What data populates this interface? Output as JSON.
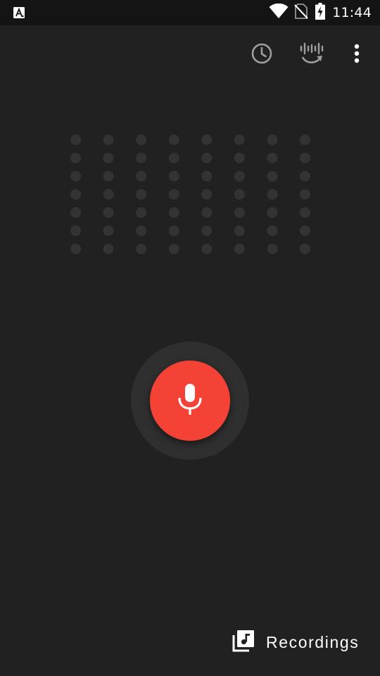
{
  "status_bar": {
    "time": "11:44",
    "icons": [
      "text-a-notification-icon",
      "wifi-icon",
      "no-sim-icon",
      "battery-charging-icon"
    ]
  },
  "toolbar": {
    "actions": [
      "history-clock-icon",
      "audio-convert-icon",
      "more-vert-icon"
    ]
  },
  "visualizer": {
    "columns": 8,
    "rows": 7,
    "dot_color": "#333333"
  },
  "record": {
    "icon": "mic-icon",
    "accent": "#f44336"
  },
  "recordings": {
    "icon": "music-library-icon",
    "label": "Recordings"
  },
  "colors": {
    "background": "#212121",
    "status_bar": "#141414",
    "icon_gray": "#9e9e9e"
  }
}
